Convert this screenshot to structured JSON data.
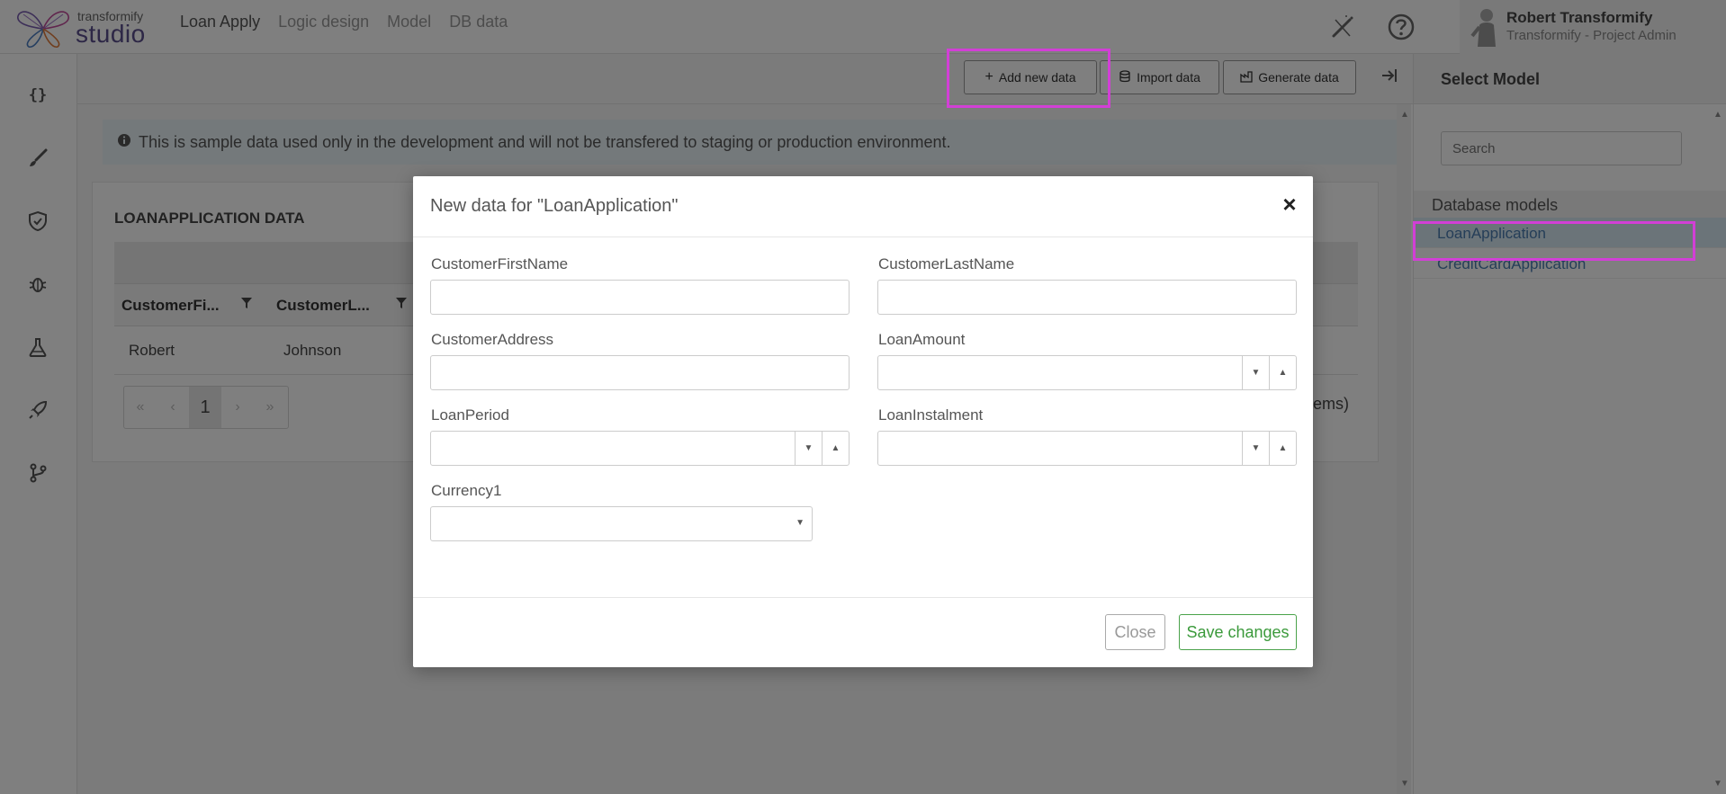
{
  "header": {
    "logo_small": "transformify",
    "logo_big": "studio",
    "nav": [
      {
        "label": "Loan Apply"
      },
      {
        "label": "Logic design"
      },
      {
        "label": "Model"
      },
      {
        "label": "DB data"
      }
    ],
    "user_name": "Robert Transformify",
    "user_role": "Transformify - Project Admin"
  },
  "sidebar": {
    "icons": [
      "code-braces-icon",
      "brush-icon",
      "shield-check-icon",
      "bug-icon",
      "flask-icon",
      "rocket-icon",
      "git-branch-icon"
    ]
  },
  "toolbar": {
    "add_label": "Add new data",
    "import_label": "Import data",
    "generate_label": "Generate data"
  },
  "main": {
    "info_text": "This is sample data used only in the development and will not be transfered to staging or production environment.",
    "card_title": "LOANAPPLICATION DATA",
    "columns": [
      "CustomerFi...",
      "CustomerL..."
    ],
    "rows": [
      {
        "first": "Robert",
        "last": "Johnson"
      }
    ],
    "pager_current": "1",
    "items_tail": "ems)"
  },
  "right_panel": {
    "title": "Select Model",
    "search_placeholder": "Search",
    "group_label": "Database models",
    "models": [
      "LoanApplication",
      "CreditCardApplication"
    ],
    "selected": "LoanApplication"
  },
  "modal": {
    "title": "New data for \"LoanApplication\"",
    "fields": {
      "first_name": "CustomerFirstName",
      "last_name": "CustomerLastName",
      "address": "CustomerAddress",
      "loan_amount": "LoanAmount",
      "loan_period": "LoanPeriod",
      "loan_instalment": "LoanInstalment",
      "currency": "Currency1"
    },
    "close_label": "Close",
    "save_label": "Save changes"
  },
  "colors": {
    "highlight": "#d23fd6",
    "save_green": "#3b9a3b",
    "link_blue": "#4a7cb0"
  }
}
